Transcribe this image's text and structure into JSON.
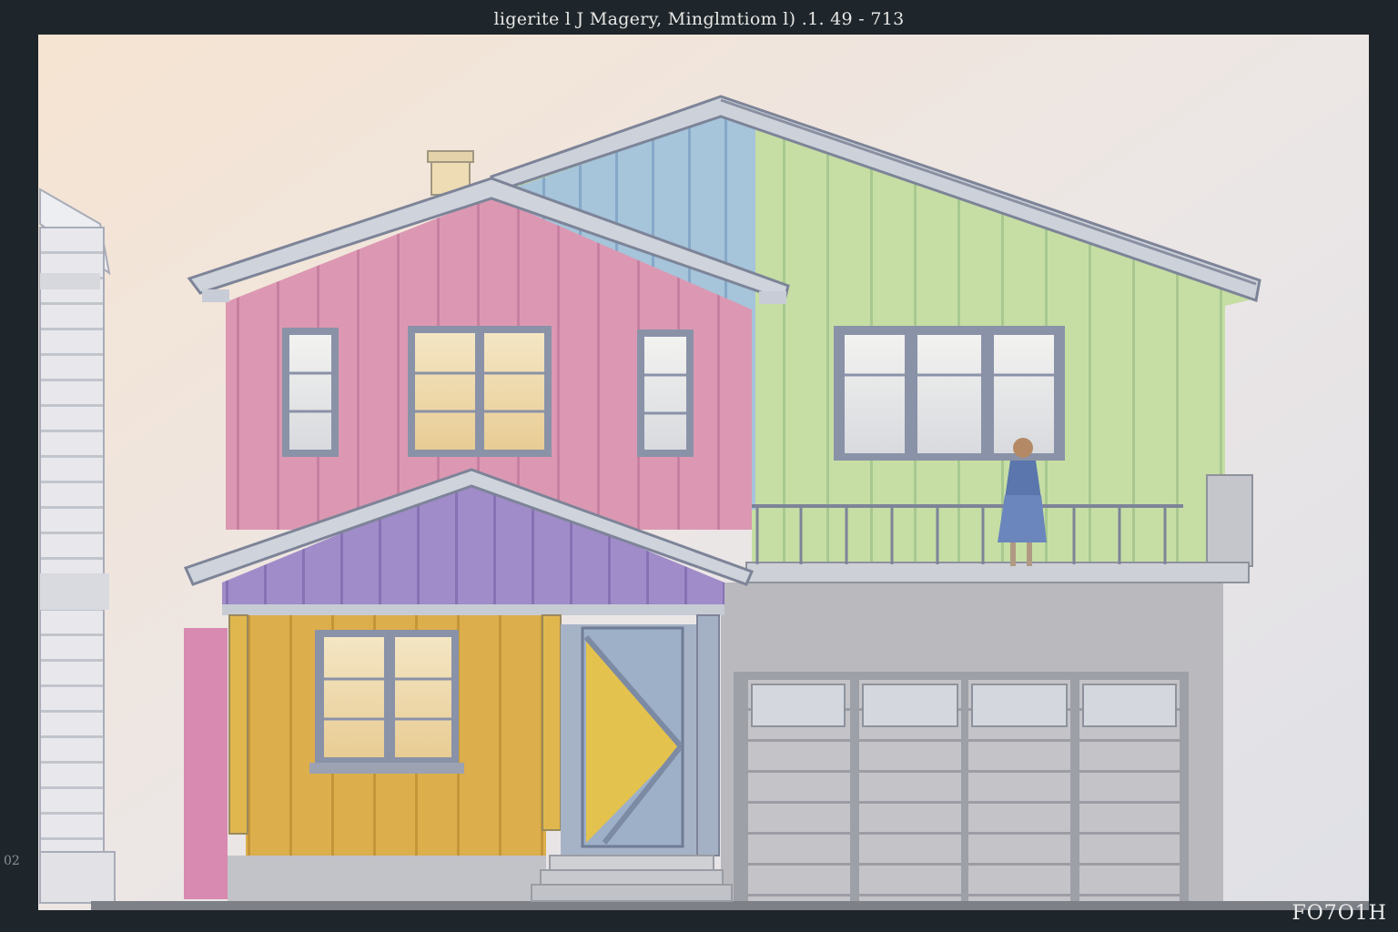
{
  "frame": {
    "title": "ligerite l J Magery, Minglmtiom l) .1. 49 - 713",
    "corner_label": "FO7O1H",
    "edge_mark": "02"
  },
  "palette": {
    "frame": "#1f262b",
    "sky_top": "#f3e6d8",
    "sky_bottom": "#e4e2e6",
    "pink_wall": "#dc98b2",
    "green_wall": "#c4dca0",
    "blue_gable": "#9cbcd4",
    "purple_gable": "#9a86c4",
    "yellow_wall": "#dcac48",
    "garage_gray": "#b8b8bc",
    "trim": "#8894a8",
    "roof": "#c8ccd4"
  },
  "scene": {
    "subject": "two-story house painting",
    "figure": "girl in blue dress on balcony"
  }
}
